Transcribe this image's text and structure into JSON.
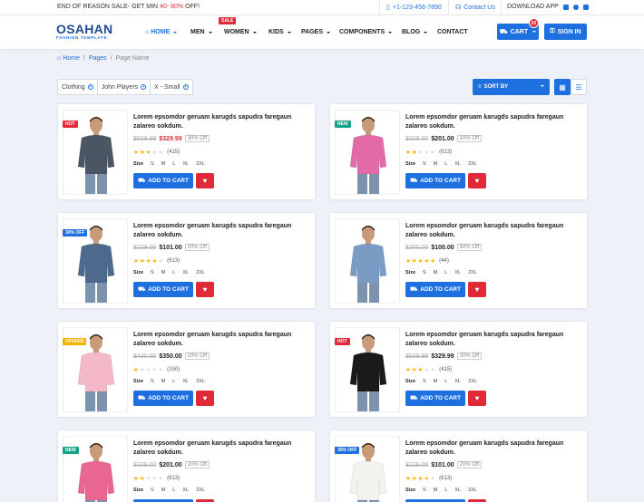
{
  "topbar": {
    "promo_prefix": "END OF REASON SALE- GET MIN ",
    "promo_highlight": "40- 80%",
    "promo_suffix": " OFF!",
    "phone": "+1-123-456-7890",
    "contact": "Contact Us",
    "download": "DOWNLOAD APP"
  },
  "brand": {
    "name": "OSAHAN",
    "tagline": "FASHION TEMPLATE"
  },
  "nav": {
    "home": "HOME",
    "men": "MEN",
    "women": "WOMEN",
    "kids": "KIDS",
    "pages": "PAGES",
    "components": "COMPONENTS",
    "blog": "BLOG",
    "contact": "CONTACT",
    "sale_badge": "SALE"
  },
  "cart": {
    "label": "CART",
    "count": "02"
  },
  "signin": "SIGN IN",
  "breadcrumb": {
    "home": "Home",
    "pages": "Pages",
    "current": "Page Name",
    "sep": "/"
  },
  "filters": [
    "Clothing",
    "John Players",
    "X - Small"
  ],
  "sort_label": "SORT BY",
  "size_label": "Size",
  "size_options": [
    "S",
    "M",
    "L",
    "XL",
    "2XL"
  ],
  "add_to_cart": "ADD TO CART",
  "colors": {
    "primary": "#1e6fe0",
    "danger": "#e02a3a",
    "success": "#16a085",
    "warning": "#f5b301"
  },
  "products": [
    {
      "title": "Lorem epsomdor geruam karugds sapudra faregaun zalareo sokdum.",
      "old_price": "$529.99",
      "new_price": "$329.99",
      "off": "30% Off",
      "rating": 3,
      "reviews": "(415)",
      "badge": "HOT",
      "badge_color": "#e02a3a",
      "price_red": true,
      "shirt": "#4a5663"
    },
    {
      "title": "Lorem epsomdor geruam karugds sapudra faregaun zalareo sokdum.",
      "old_price": "$329.00",
      "new_price": "$201.00",
      "off": "10% Off",
      "rating": 2,
      "reviews": "(613)",
      "badge": "NEW",
      "badge_color": "#16a085",
      "price_red": false,
      "shirt": "#e26aa6"
    },
    {
      "title": "Lorem epsomdor geruam karugds sapudra faregaun zalareo sokdum.",
      "old_price": "$229.00",
      "new_price": "$101.00",
      "off": "20% Off",
      "rating": 4,
      "reviews": "(613)",
      "badge": "30% OFF",
      "badge_color": "#1e6fe0",
      "price_red": false,
      "shirt": "#4d6a8c"
    },
    {
      "title": "Lorem epsomdor geruam karugds sapudra faregaun zalareo sokdum.",
      "old_price": "$200.00",
      "new_price": "$100.00",
      "off": "50% Off",
      "rating": 5,
      "reviews": "(44)",
      "badge": "",
      "badge_color": "",
      "price_red": false,
      "shirt": "#7a9cc4"
    },
    {
      "title": "Lorem epsomdor geruam karugds sapudra faregaun zalareo sokdum.",
      "old_price": "$430.00",
      "new_price": "$350.00",
      "off": "20% Off",
      "rating": 1,
      "reviews": "(150)",
      "badge": "OFFERS",
      "badge_color": "#f5b301",
      "price_red": false,
      "shirt": "#f4b8c6"
    },
    {
      "title": "Lorem epsomdor geruam karugds sapudra faregaun zalareo sokdum.",
      "old_price": "$529.99",
      "new_price": "$329.99",
      "off": "30% Off",
      "rating": 3,
      "reviews": "(415)",
      "badge": "HOT",
      "badge_color": "#e02a3a",
      "price_red": false,
      "shirt": "#1a1a1a"
    },
    {
      "title": "Lorem epsomdor geruam karugds sapudra faregaun zalareo sokdum.",
      "old_price": "$329.00",
      "new_price": "$201.00",
      "off": "10% Off",
      "rating": 2,
      "reviews": "(613)",
      "badge": "NEW",
      "badge_color": "#16a085",
      "price_red": false,
      "shirt": "#e8668f"
    },
    {
      "title": "Lorem epsomdor geruam karugds sapudra faregaun zalareo sokdum.",
      "old_price": "$229.00",
      "new_price": "$101.00",
      "off": "20% Off",
      "rating": 4,
      "reviews": "(613)",
      "badge": "30% OFF",
      "badge_color": "#1e6fe0",
      "price_red": false,
      "shirt": "#f4f2ee"
    }
  ]
}
